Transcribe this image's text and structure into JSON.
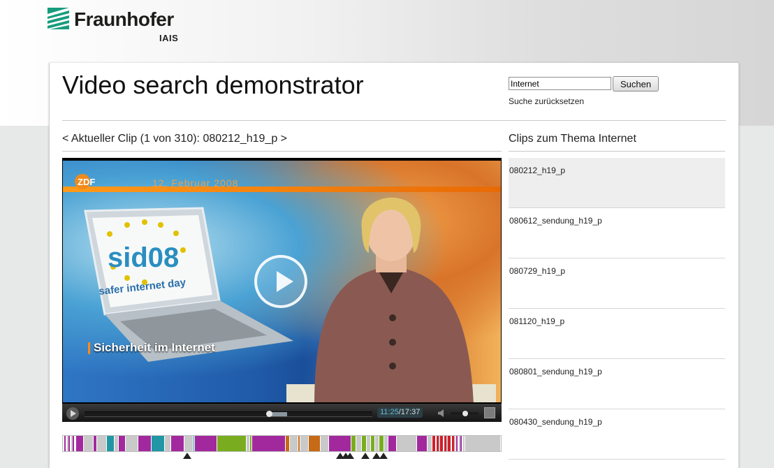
{
  "header": {
    "logo_name": "Fraunhofer",
    "logo_sub": "IAIS"
  },
  "page": {
    "title": "Video search demonstrator"
  },
  "search": {
    "value": "Internet",
    "button_label": "Suchen",
    "reset_label": "Suche zurücksetzen"
  },
  "clip_nav": {
    "prev": "<",
    "label": "Aktueller Clip (1 von 310): 080212_h19_p",
    "next": ">"
  },
  "video": {
    "channel_logo": "ZDF",
    "date_overlay": "12. Februar 2008",
    "caption": "Sicherheit im Internet",
    "laptop_text_1": "sid08",
    "laptop_text_2": "safer internet day",
    "player": {
      "current_time": "11:25",
      "separator": "/",
      "duration": "17:37",
      "progress_fraction": 0.64
    }
  },
  "sidebar": {
    "heading": "Clips zum Thema Internet",
    "clips": [
      {
        "label": "080212_h19_p",
        "active": true
      },
      {
        "label": "080612_sendung_h19_p",
        "active": false
      },
      {
        "label": "080729_h19_p",
        "active": false
      },
      {
        "label": "081120_h19_p",
        "active": false
      },
      {
        "label": "080801_sendung_h19_p",
        "active": false
      },
      {
        "label": "080430_sendung_h19_p",
        "active": false
      }
    ]
  },
  "timeline": {
    "colors": {
      "magenta": "#a2299d",
      "green": "#79ad1f",
      "teal": "#2196a4",
      "grey": "#c9c9c9",
      "orange": "#c56a16",
      "red": "#cf1f2b"
    },
    "segments": [
      {
        "start": 0.0,
        "end": 0.003,
        "color": "white"
      },
      {
        "start": 0.003,
        "end": 0.03,
        "color": "hatch"
      },
      {
        "start": 0.03,
        "end": 0.048,
        "color": "magenta"
      },
      {
        "start": 0.048,
        "end": 0.07,
        "color": "grey"
      },
      {
        "start": 0.07,
        "end": 0.078,
        "color": "magenta"
      },
      {
        "start": 0.078,
        "end": 0.1,
        "color": "grey"
      },
      {
        "start": 0.1,
        "end": 0.118,
        "color": "teal"
      },
      {
        "start": 0.118,
        "end": 0.128,
        "color": "grey"
      },
      {
        "start": 0.128,
        "end": 0.143,
        "color": "magenta"
      },
      {
        "start": 0.143,
        "end": 0.173,
        "color": "grey"
      },
      {
        "start": 0.173,
        "end": 0.203,
        "color": "magenta"
      },
      {
        "start": 0.203,
        "end": 0.233,
        "color": "teal"
      },
      {
        "start": 0.233,
        "end": 0.248,
        "color": "grey"
      },
      {
        "start": 0.248,
        "end": 0.278,
        "color": "magenta"
      },
      {
        "start": 0.278,
        "end": 0.298,
        "color": "grey"
      },
      {
        "start": 0.298,
        "end": 0.302,
        "color": "teal"
      },
      {
        "start": 0.302,
        "end": 0.352,
        "color": "magenta"
      },
      {
        "start": 0.352,
        "end": 0.42,
        "color": "green"
      },
      {
        "start": 0.42,
        "end": 0.428,
        "color": "grey"
      },
      {
        "start": 0.428,
        "end": 0.432,
        "color": "green"
      },
      {
        "start": 0.432,
        "end": 0.508,
        "color": "magenta"
      },
      {
        "start": 0.508,
        "end": 0.518,
        "color": "orange"
      },
      {
        "start": 0.518,
        "end": 0.538,
        "color": "grey"
      },
      {
        "start": 0.538,
        "end": 0.542,
        "color": "orange"
      },
      {
        "start": 0.542,
        "end": 0.562,
        "color": "grey"
      },
      {
        "start": 0.562,
        "end": 0.588,
        "color": "orange"
      },
      {
        "start": 0.588,
        "end": 0.608,
        "color": "grey"
      },
      {
        "start": 0.608,
        "end": 0.658,
        "color": "magenta"
      },
      {
        "start": 0.658,
        "end": 0.67,
        "color": "green"
      },
      {
        "start": 0.67,
        "end": 0.683,
        "color": "grey"
      },
      {
        "start": 0.683,
        "end": 0.693,
        "color": "green"
      },
      {
        "start": 0.693,
        "end": 0.703,
        "color": "grey"
      },
      {
        "start": 0.703,
        "end": 0.713,
        "color": "green"
      },
      {
        "start": 0.713,
        "end": 0.723,
        "color": "grey"
      },
      {
        "start": 0.723,
        "end": 0.733,
        "color": "green"
      },
      {
        "start": 0.733,
        "end": 0.743,
        "color": "grey"
      },
      {
        "start": 0.743,
        "end": 0.763,
        "color": "magenta"
      },
      {
        "start": 0.763,
        "end": 0.808,
        "color": "grey"
      },
      {
        "start": 0.808,
        "end": 0.833,
        "color": "magenta"
      },
      {
        "start": 0.833,
        "end": 0.843,
        "color": "grey"
      },
      {
        "start": 0.843,
        "end": 0.898,
        "color": "red-stripe"
      },
      {
        "start": 0.898,
        "end": 0.918,
        "color": "hatch"
      },
      {
        "start": 0.918,
        "end": 1.0,
        "color": "grey"
      }
    ],
    "markers": [
      0.285,
      0.635,
      0.647,
      0.657,
      0.692,
      0.718,
      0.733
    ]
  }
}
